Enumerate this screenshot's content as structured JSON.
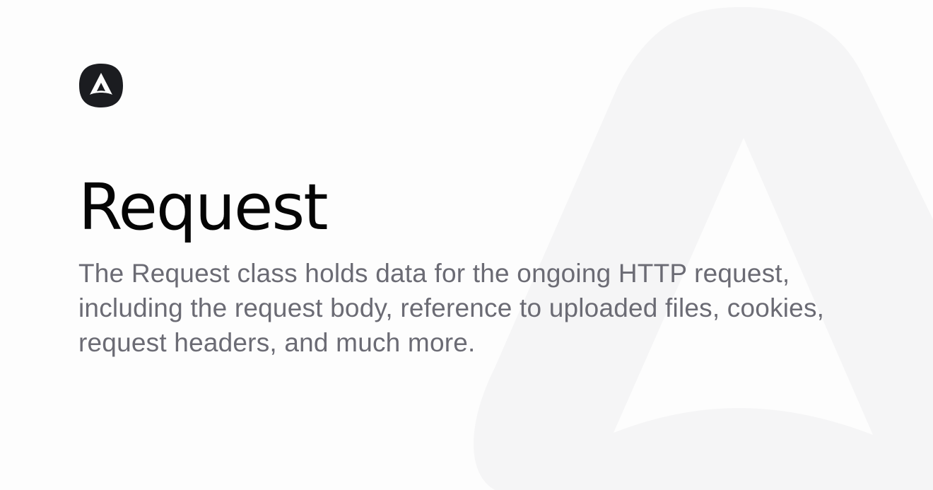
{
  "brand": {
    "logo_icon": "adonisjs-logo-icon",
    "background_icon": "adonisjs-watermark-icon",
    "logo_color": "#1b1c20",
    "watermark_color": "#f4f4f5"
  },
  "main": {
    "title": "Request",
    "description": "The Request class holds data for the ongoing HTTP request, including the request body, reference to uploaded files, cookies, request headers, and much more."
  }
}
